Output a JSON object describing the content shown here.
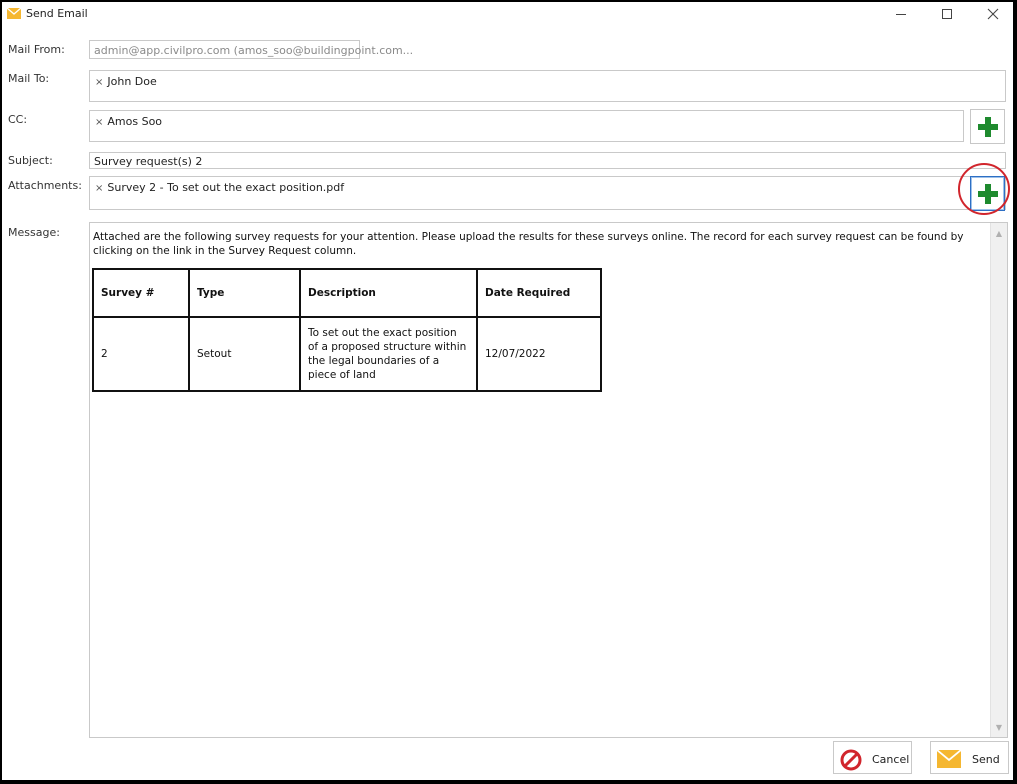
{
  "window": {
    "title": "Send Email",
    "minimize_glyph": "—",
    "maximize_glyph": "☐",
    "close_glyph": "✕"
  },
  "labels": {
    "mail_from": "Mail From:",
    "mail_to": "Mail To:",
    "cc": "CC:",
    "subject": "Subject:",
    "attachments": "Attachments:",
    "message": "Message:"
  },
  "fields": {
    "mail_from": "admin@app.civilpro.com (amos_soo@buildingpoint.com...",
    "mail_to_tokens": [
      "John  Doe"
    ],
    "cc_tokens": [
      "Amos Soo"
    ],
    "subject": "Survey request(s) 2",
    "attachment_tokens": [
      "Survey 2 - To set out the exact position.pdf"
    ]
  },
  "token_remove_glyph": "×",
  "message": {
    "intro": "Attached are the following survey requests for your attention. Please upload the results for these surveys online. The record for each survey request can be found by clicking on the link in the Survey Request column.",
    "table": {
      "headers": [
        "Survey #",
        "Type",
        "Description",
        "Date Required"
      ],
      "rows": [
        [
          "2",
          "Setout",
          "To set out the exact position of a proposed structure within the legal boundaries of a piece of land",
          "12/07/2022"
        ]
      ]
    }
  },
  "buttons": {
    "cancel": "Cancel",
    "send": "Send"
  },
  "icons": {
    "app": "envelope-icon",
    "add": "plus-icon",
    "cancel": "no-entry-icon",
    "send": "envelope-icon"
  },
  "colors": {
    "envelope": "#f5b731",
    "plus_green": "#1e8a2e",
    "cancel_red": "#d1252c",
    "highlight_ring": "#d1252c",
    "focus_blue": "#2d6fc4"
  }
}
